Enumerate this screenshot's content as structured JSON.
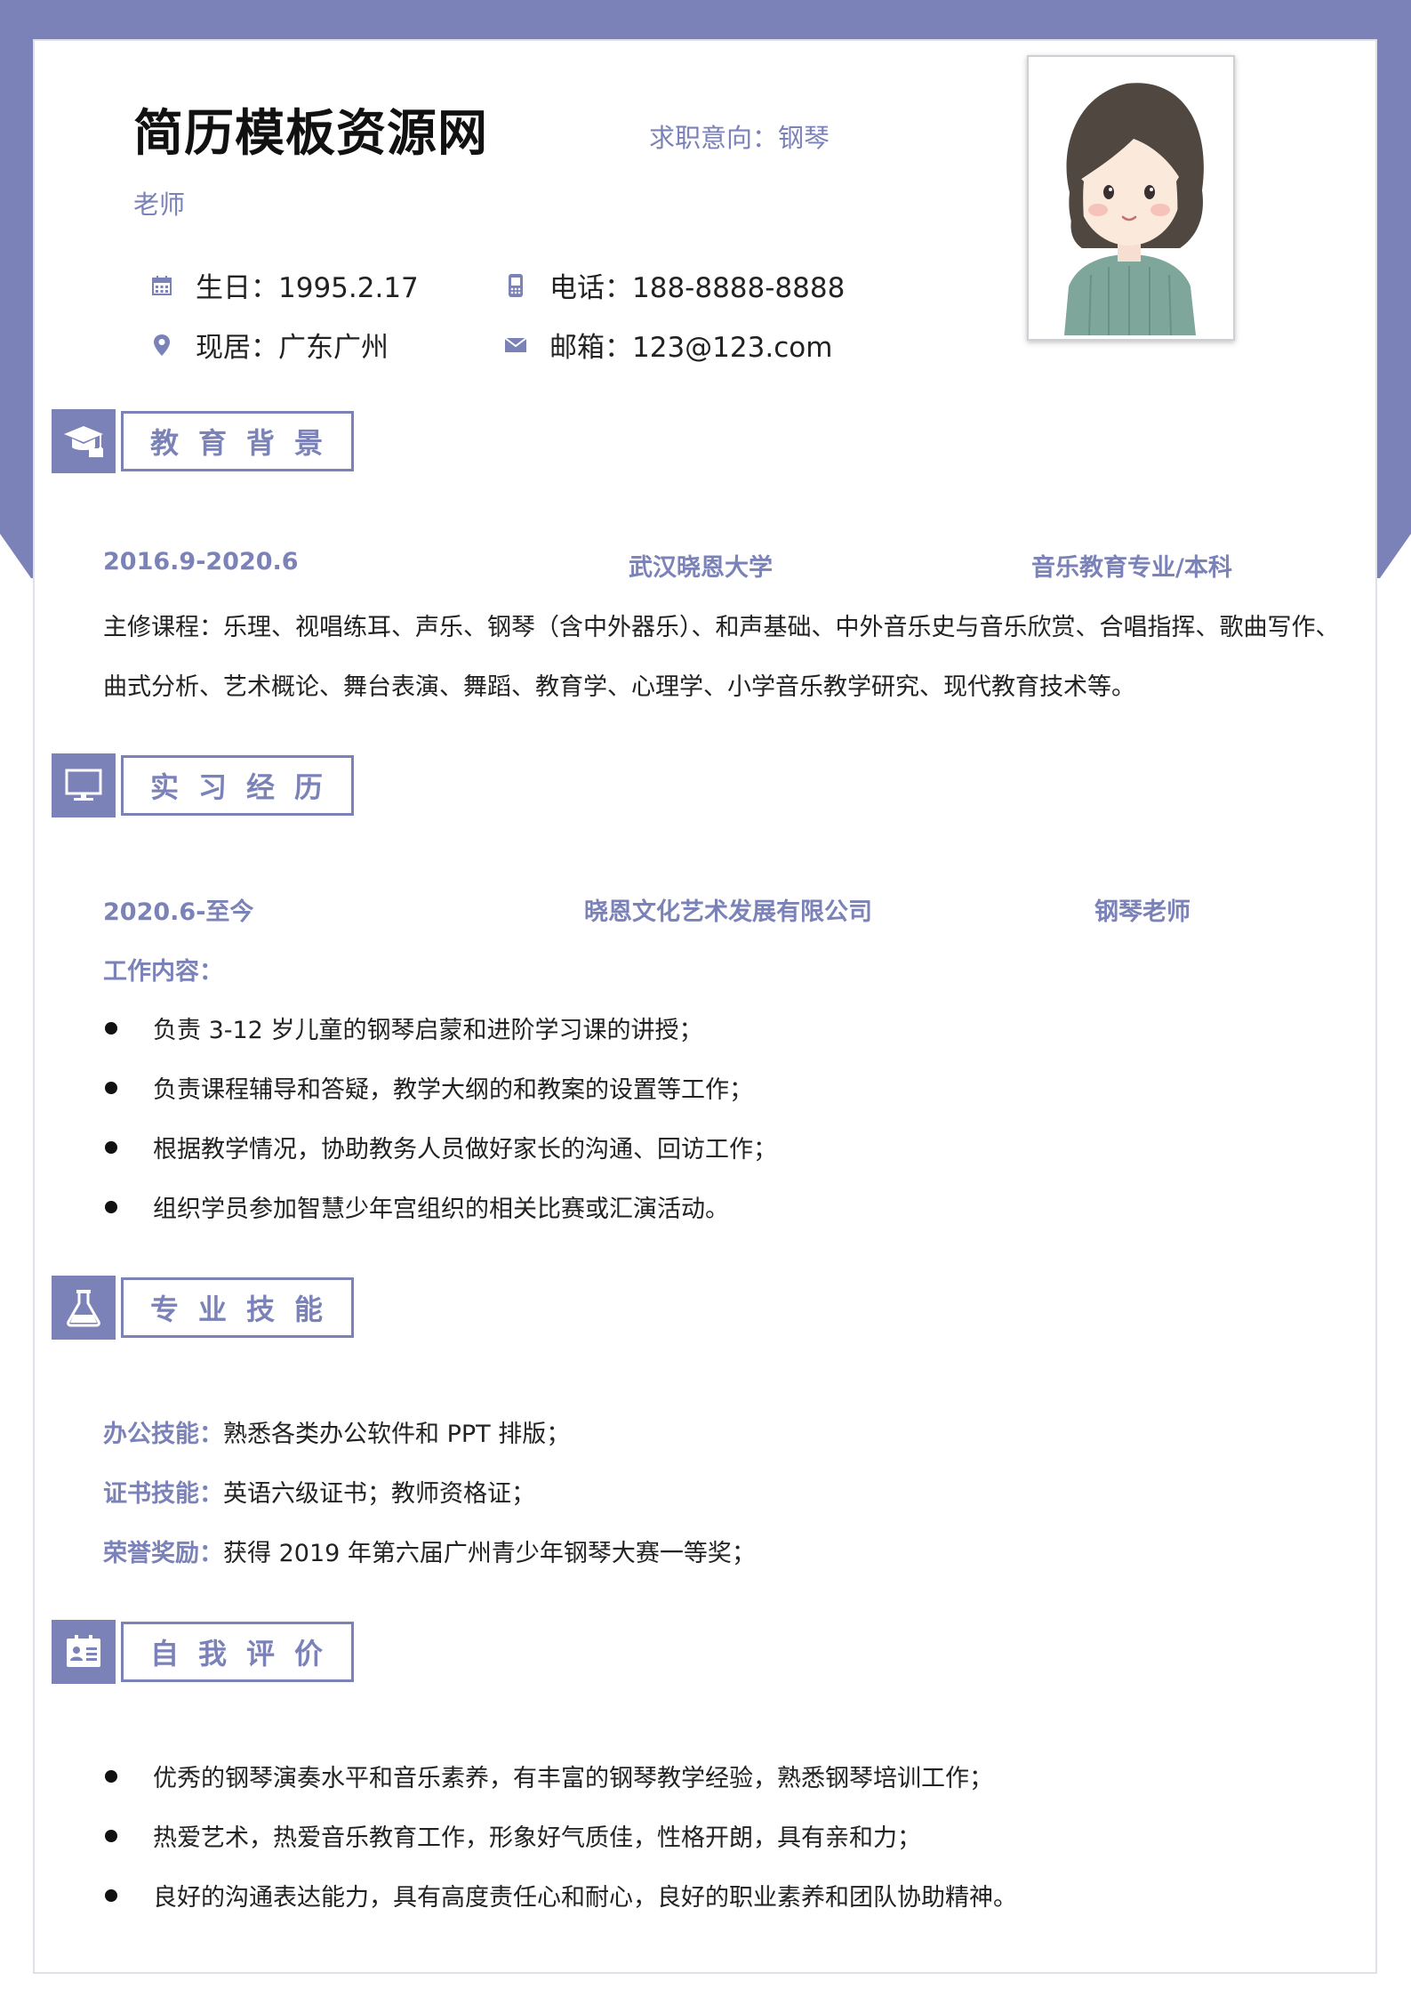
{
  "colors": {
    "accent": "#7b82b8",
    "text": "#222222"
  },
  "header": {
    "name": "简历模板资源网",
    "intent_line1": "求职意向：钢琴",
    "intent_line2": "老师",
    "info": {
      "birth": "生日：1995.2.17",
      "phone": "电话：188-8888-8888",
      "location": "现居：广东广州",
      "email": "邮箱：123@123.com"
    },
    "icons": [
      "calendar-icon",
      "phone-icon",
      "location-pin-icon",
      "mail-icon"
    ]
  },
  "sections": {
    "education": {
      "title": "教育背景",
      "icon": "graduation-cap-icon",
      "period": "2016.9-2020.6",
      "school": "武汉晓恩大学",
      "major": "音乐教育专业/本科",
      "courses_line1": "主修课程：乐理、视唱练耳、声乐、钢琴（含中外器乐）、和声基础、中外音乐史与音乐欣赏、合唱指挥、歌曲写作、",
      "courses_line2": "曲式分析、艺术概论、舞台表演、舞蹈、教育学、心理学、小学音乐教学研究、现代教育技术等。"
    },
    "internship": {
      "title": "实习经历",
      "icon": "monitor-icon",
      "period": "2020.6-至今",
      "company": "晓恩文化艺术发展有限公司",
      "position": "钢琴老师",
      "content_label": "工作内容：",
      "items": [
        "负责 3-12 岁儿童的钢琴启蒙和进阶学习课的讲授；",
        "负责课程辅导和答疑，教学大纲的和教案的设置等工作；",
        "根据教学情况，协助教务人员做好家长的沟通、回访工作；",
        "组织学员参加智慧少年宫组织的相关比赛或汇演活动。"
      ]
    },
    "skills": {
      "title": "专业技能",
      "icon": "flask-icon",
      "rows": [
        {
          "label": "办公技能：",
          "text": "熟悉各类办公软件和 PPT 排版；"
        },
        {
          "label": "证书技能：",
          "text": "英语六级证书；教师资格证；"
        },
        {
          "label": "荣誉奖励：",
          "text": "获得 2019 年第六届广州青少年钢琴大赛一等奖；"
        }
      ]
    },
    "self_eval": {
      "title": "自我评价",
      "icon": "id-card-icon",
      "items": [
        "优秀的钢琴演奏水平和音乐素养，有丰富的钢琴教学经验，熟悉钢琴培训工作；",
        "热爱艺术，热爱音乐教育工作，形象好气质佳，性格开朗，具有亲和力；",
        "良好的沟通表达能力，具有高度责任心和耐心，良好的职业素养和团队协助精神。"
      ]
    }
  }
}
